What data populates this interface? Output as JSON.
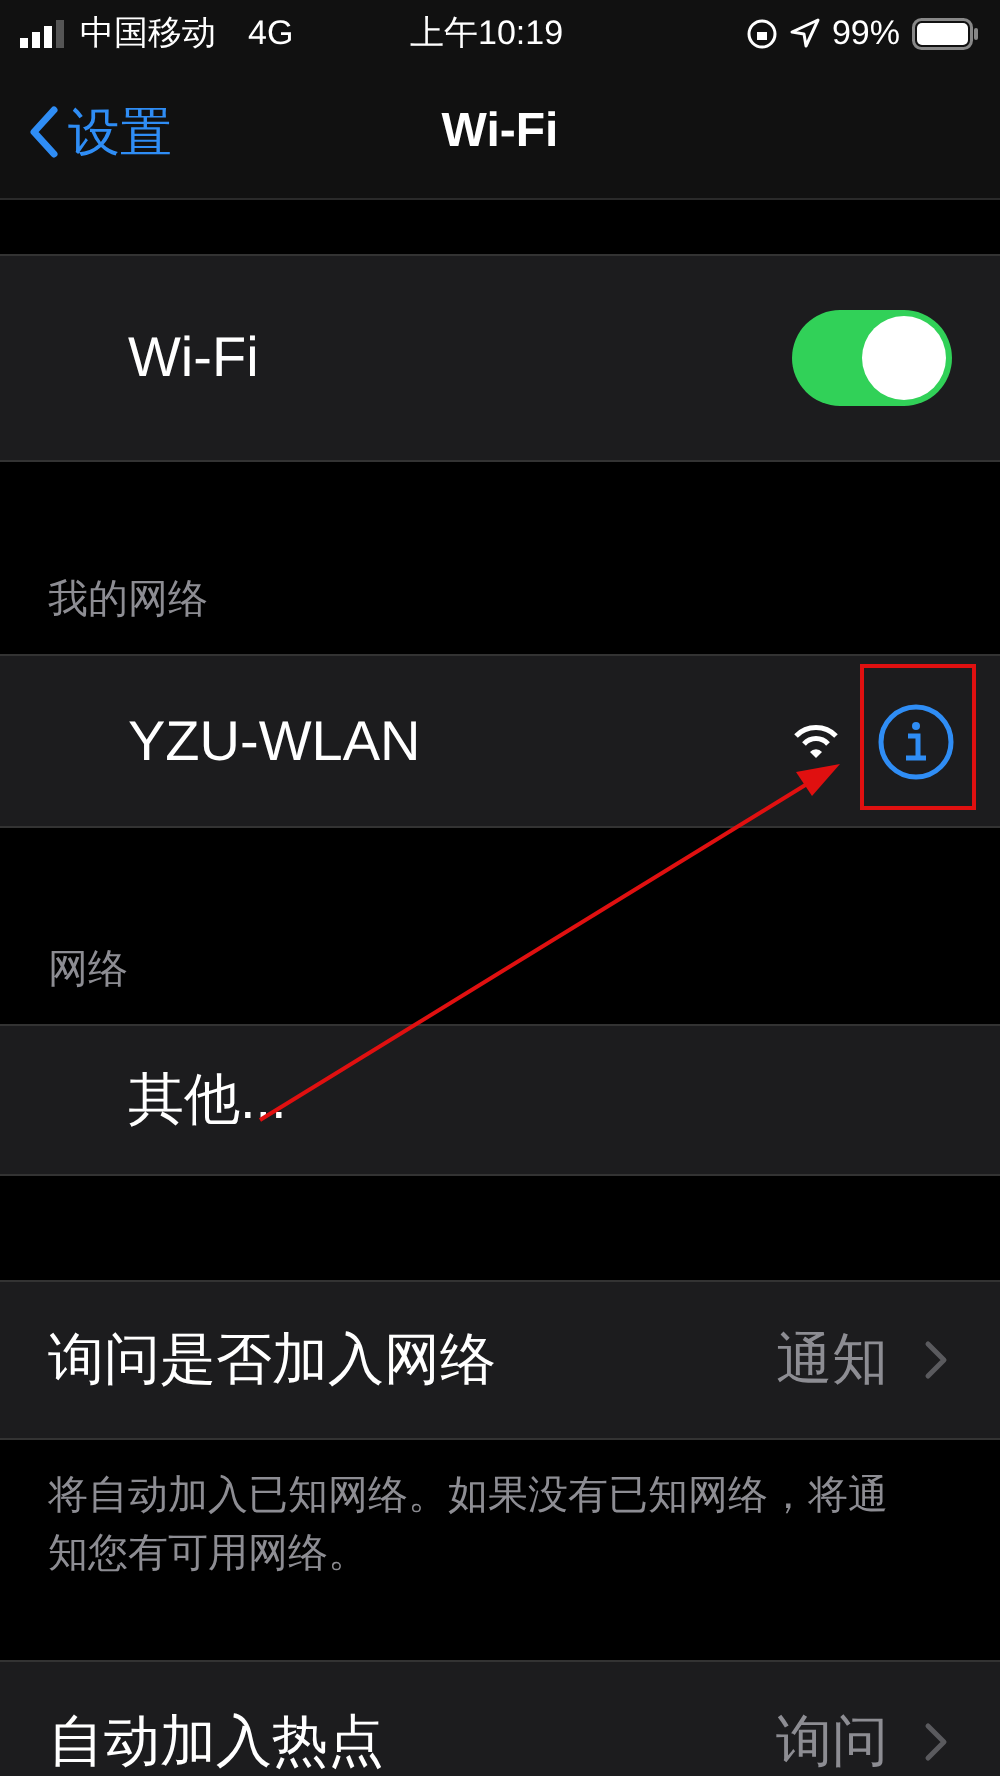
{
  "status_bar": {
    "carrier": "中国移动",
    "network": "4G",
    "time": "上午10:19",
    "battery": "99%"
  },
  "nav": {
    "back": "设置",
    "title": "Wi-Fi"
  },
  "wifi_toggle": {
    "label": "Wi-Fi",
    "on": true
  },
  "my_networks": {
    "header": "我的网络",
    "items": [
      {
        "name": "YZU-WLAN"
      }
    ]
  },
  "networks": {
    "header": "网络",
    "items": [
      {
        "name": "其他..."
      }
    ]
  },
  "ask_to_join": {
    "label": "询问是否加入网络",
    "value": "通知",
    "footer": "将自动加入已知网络。如果没有已知网络，将通知您有可用网络。"
  },
  "auto_join_hotspot": {
    "label": "自动加入热点",
    "value": "询问"
  }
}
